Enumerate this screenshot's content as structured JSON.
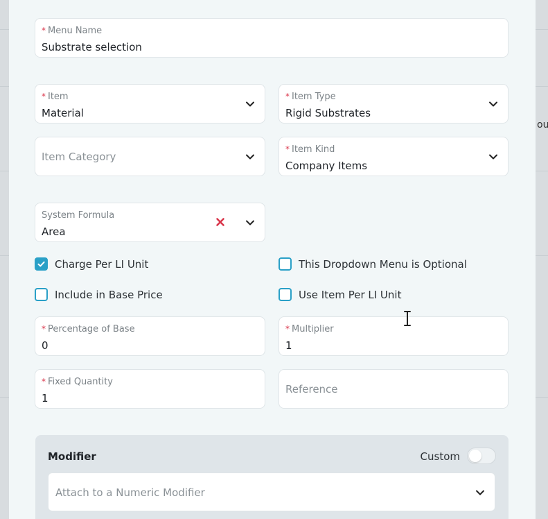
{
  "backdrop": {
    "edge_text_right": "our"
  },
  "form": {
    "menu_name": {
      "label": "Menu Name",
      "required": "*",
      "value": "Substrate selection"
    },
    "item": {
      "label": "Item",
      "required": "*",
      "value": "Material"
    },
    "item_type": {
      "label": "Item Type",
      "required": "*",
      "value": "Rigid Substrates"
    },
    "item_category": {
      "placeholder": "Item Category"
    },
    "item_kind": {
      "label": "Item Kind",
      "required": "*",
      "value": "Company Items"
    },
    "system_formula": {
      "label": "System Formula",
      "value": "Area"
    },
    "checkboxes": {
      "charge_per_li_unit": {
        "label": "Charge Per LI Unit",
        "checked": true
      },
      "dropdown_optional": {
        "label": "This Dropdown Menu is Optional",
        "checked": false
      },
      "include_base_price": {
        "label": "Include in Base Price",
        "checked": false
      },
      "use_item_per_li_unit": {
        "label": "Use Item Per LI Unit",
        "checked": false
      }
    },
    "percentage_of_base": {
      "label": "Percentage of Base",
      "required": "*",
      "value": "0"
    },
    "multiplier": {
      "label": "Multiplier",
      "required": "*",
      "value": "1"
    },
    "fixed_quantity": {
      "label": "Fixed Quantity",
      "required": "*",
      "value": "1"
    },
    "reference": {
      "placeholder": "Reference"
    }
  },
  "modifier": {
    "title": "Modifier",
    "custom_label": "Custom",
    "custom_on": false,
    "select_placeholder": "Attach to a Numeric Modifier"
  },
  "icons": {
    "chevron": "chevron-down-icon",
    "clear": "clear-x-icon",
    "check": "check-icon",
    "cursor": "text-cursor-icon"
  },
  "colors": {
    "accent": "#2aa0c7",
    "required": "#d9364b",
    "clear_x": "#d9364b",
    "modal_bg": "#f2f7f8"
  }
}
